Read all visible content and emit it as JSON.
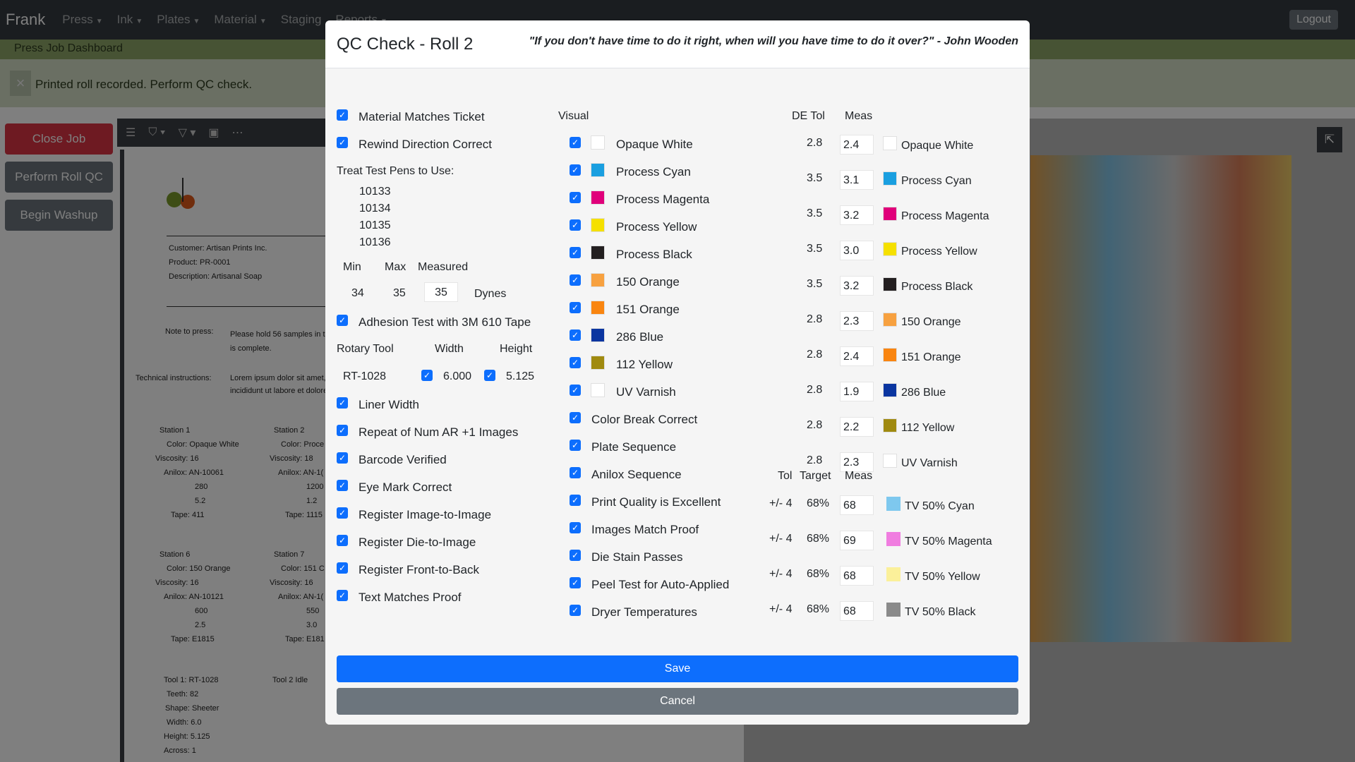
{
  "app": {
    "brand": "Frank",
    "nav": [
      "Press",
      "Ink",
      "Plates",
      "Material",
      "Staging",
      "Reports"
    ],
    "logout": "Logout",
    "subtitle": "Press Job Dashboard",
    "alert": "Printed roll recorded. Perform QC check."
  },
  "sidebar": {
    "close_job": "Close Job",
    "perform_qc": "Perform Roll QC",
    "begin_washup": "Begin Washup"
  },
  "ticket": {
    "customer_label": "Customer:",
    "customer": "Artisan Prints Inc.",
    "product_label": "Product:",
    "product": "PR-0001",
    "description_label": "Description:",
    "description": "Artisanal Soap",
    "note_label": "Note to press:",
    "note_1": "Please hold 56 samples in th",
    "note_2": "is complete.",
    "tech_label": "Technical instructions:",
    "tech_1": "Lorem ipsum dolor sit amet,",
    "tech_2": "incididunt ut labore et dolore",
    "stations": [
      {
        "title": "Station 1",
        "color": "Opaque White",
        "viscosity": "16",
        "anilox": "AN-10061",
        "v1": "280",
        "v2": "5.2",
        "tape": "411"
      },
      {
        "title": "Station 2",
        "color": "Proce",
        "viscosity": "18",
        "anilox": "AN-1(",
        "v1": "1200",
        "v2": "1.2",
        "tape": "1115"
      },
      {
        "title": "Station 6",
        "color": "150 Orange",
        "viscosity": "16",
        "anilox": "AN-10121",
        "v1": "600",
        "v2": "2.5",
        "tape": "E1815"
      },
      {
        "title": "Station 7",
        "color": "151 C",
        "viscosity": "16",
        "anilox": "AN-1(",
        "v1": "550",
        "v2": "3.0",
        "tape": "E181"
      }
    ],
    "labels": {
      "color": "Color:",
      "viscosity": "Viscosity:",
      "anilox": "Anilox:",
      "tape": "Tape:"
    },
    "tool": {
      "title": "Tool 1:",
      "name": "RT-1028",
      "idle": "Tool 2 Idle",
      "teeth_label": "Teeth:",
      "teeth": "82",
      "shape_label": "Shape:",
      "shape": "Sheeter",
      "width_label": "Width:",
      "width": "6.0",
      "height_label": "Height:",
      "height": "5.125",
      "across_label": "Across:",
      "across": "1"
    }
  },
  "modal": {
    "title": "QC Check - Roll 2",
    "quote": "\"If you don't have time to do it right, when will you have time to do it over?\" - John Wooden",
    "col1": {
      "material_matches": "Material Matches Ticket",
      "rewind_direction": "Rewind Direction Correct",
      "treat_pens_label": "Treat Test Pens to Use:",
      "pens": [
        "10133",
        "10134",
        "10135",
        "10136"
      ],
      "min_label": "Min",
      "max_label": "Max",
      "measured_label": "Measured",
      "min": "34",
      "max": "35",
      "measured": "35",
      "dynes": "Dynes",
      "adhesion": "Adhesion Test with 3M 610 Tape",
      "rotary_label": "Rotary Tool",
      "width_label": "Width",
      "height_label": "Height",
      "rotary": "RT-1028",
      "width": "6.000",
      "height": "5.125",
      "checks": [
        "Liner Width",
        "Repeat of Num AR +1 Images",
        "Barcode Verified",
        "Eye Mark Correct",
        "Register Image-to-Image",
        "Register Die-to-Image",
        "Register Front-to-Back",
        "Text Matches Proof"
      ]
    },
    "col2": {
      "visual_label": "Visual",
      "colors": [
        {
          "name": "Opaque White",
          "hex": "#ffffff"
        },
        {
          "name": "Process Cyan",
          "hex": "#1a9fe0"
        },
        {
          "name": "Process Magenta",
          "hex": "#e0007a"
        },
        {
          "name": "Process Yellow",
          "hex": "#f5e000"
        },
        {
          "name": "Process Black",
          "hex": "#231f20"
        },
        {
          "name": "150 Orange",
          "hex": "#f7a140"
        },
        {
          "name": "151 Orange",
          "hex": "#f98510"
        },
        {
          "name": "286 Blue",
          "hex": "#0a35a0"
        },
        {
          "name": "112 Yellow",
          "hex": "#a08a10"
        },
        {
          "name": "UV Varnish",
          "hex": "#ffffff"
        }
      ],
      "checks": [
        "Color Break Correct",
        "Plate Sequence",
        "Anilox Sequence",
        "Print Quality is Excellent",
        "Images Match Proof",
        "Die Stain Passes",
        "Peel Test for Auto-Applied",
        "Dryer Temperatures"
      ]
    },
    "col3": {
      "de_tol_label": "DE Tol",
      "meas_label": "Meas",
      "de": [
        {
          "tol": "2.8",
          "meas": "2.4",
          "name": "Opaque White",
          "hex": "#ffffff"
        },
        {
          "tol": "3.5",
          "meas": "3.1",
          "name": "Process Cyan",
          "hex": "#1a9fe0"
        },
        {
          "tol": "3.5",
          "meas": "3.2",
          "name": "Process Magenta",
          "hex": "#e0007a"
        },
        {
          "tol": "3.5",
          "meas": "3.0",
          "name": "Process Yellow",
          "hex": "#f5e000"
        },
        {
          "tol": "3.5",
          "meas": "3.2",
          "name": "Process Black",
          "hex": "#231f20"
        },
        {
          "tol": "2.8",
          "meas": "2.3",
          "name": "150 Orange",
          "hex": "#f7a140"
        },
        {
          "tol": "2.8",
          "meas": "2.4",
          "name": "151 Orange",
          "hex": "#f98510"
        },
        {
          "tol": "2.8",
          "meas": "1.9",
          "name": "286 Blue",
          "hex": "#0a35a0"
        },
        {
          "tol": "2.8",
          "meas": "2.2",
          "name": "112 Yellow",
          "hex": "#a08a10"
        },
        {
          "tol": "2.8",
          "meas": "2.3",
          "name": "UV Varnish",
          "hex": "#ffffff"
        }
      ],
      "tol_label": "Tol",
      "target_label": "Target",
      "meas2_label": "Meas",
      "tv": [
        {
          "tol": "+/- 4",
          "target": "68%",
          "meas": "68",
          "name": "TV 50% Cyan",
          "hex": "#7ec8ee"
        },
        {
          "tol": "+/- 4",
          "target": "68%",
          "meas": "69",
          "name": "TV 50% Magenta",
          "hex": "#f07de0"
        },
        {
          "tol": "+/- 4",
          "target": "68%",
          "meas": "68",
          "name": "TV 50% Yellow",
          "hex": "#fbf09a"
        },
        {
          "tol": "+/- 4",
          "target": "68%",
          "meas": "68",
          "name": "TV 50% Black",
          "hex": "#8a8a8a"
        }
      ]
    },
    "save": "Save",
    "cancel": "Cancel"
  }
}
